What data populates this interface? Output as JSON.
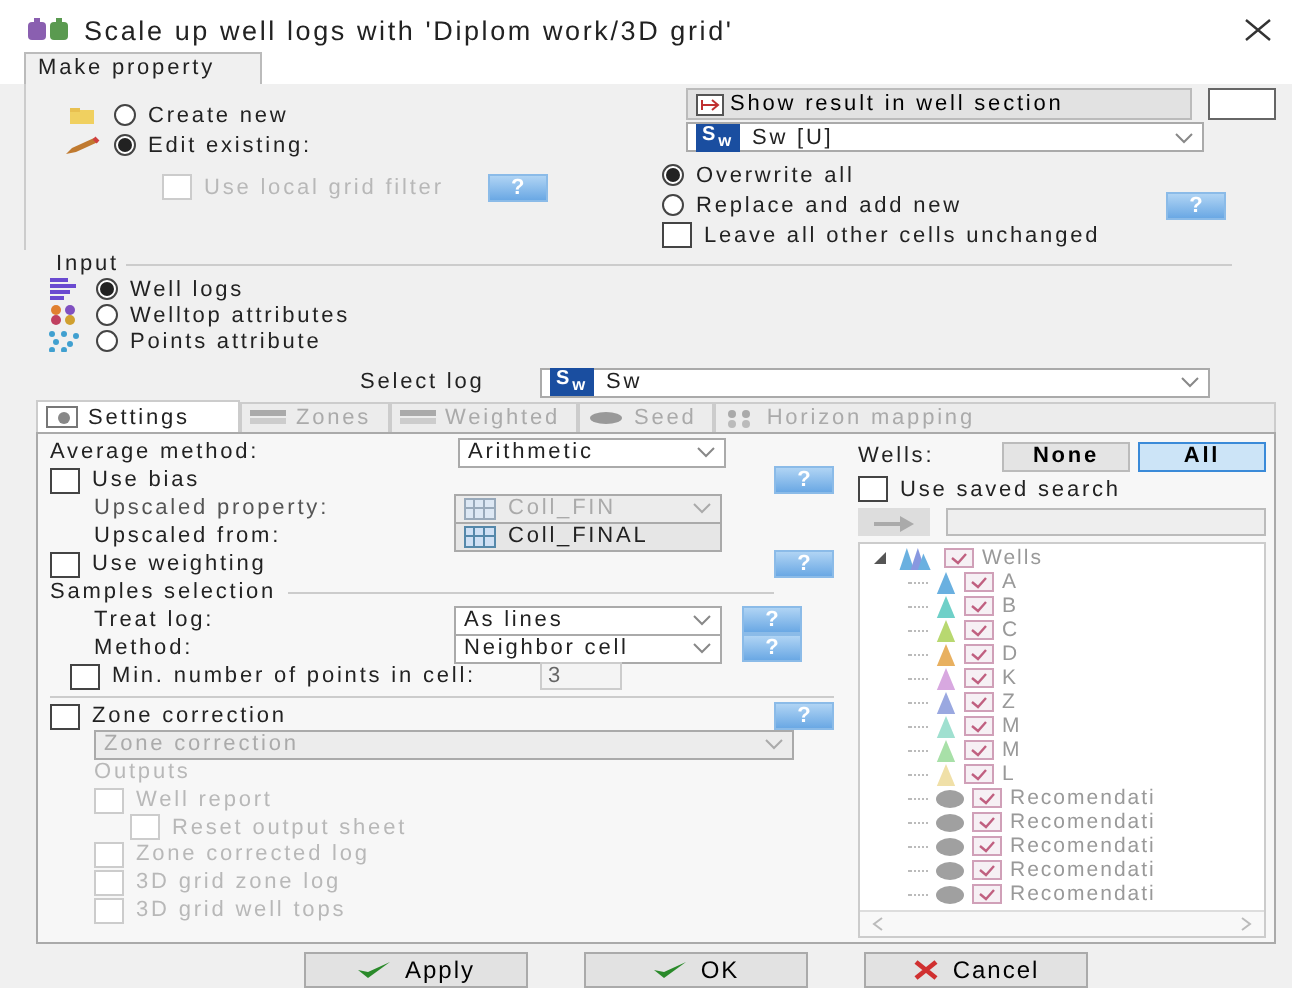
{
  "window": {
    "title": "Scale up well logs with 'Diplom work/3D grid'"
  },
  "top_tabs": [
    {
      "label": "Make property",
      "selected": true
    }
  ],
  "make_mode": [
    {
      "label": "Create new",
      "selected": false,
      "kind": "folder"
    },
    {
      "label": "Edit existing:",
      "selected": true,
      "kind": "pencil"
    }
  ],
  "local_grid_filter": {
    "label": "Use local grid filter",
    "checked": false,
    "disabled": true,
    "help": "?"
  },
  "show_result_button": "Show result in well section",
  "property_dropdown": {
    "badge": "S$_{w}$",
    "value": "Sw [U]"
  },
  "write_mode": [
    {
      "label": "Overwrite all",
      "selected": true
    },
    {
      "label": "Replace and add new",
      "selected": false,
      "help": "?"
    }
  ],
  "leave_unchanged": {
    "label": "Leave all other cells unchanged",
    "checked": false
  },
  "input": {
    "label": "Input",
    "options": [
      {
        "label": "Well logs",
        "selected": true,
        "kind": "logs"
      },
      {
        "label": "Welltop attributes",
        "selected": false,
        "kind": "tops"
      },
      {
        "label": "Points attribute",
        "selected": false,
        "kind": "points"
      }
    ]
  },
  "select_log": {
    "label": "Select log",
    "badge": "S$_{w}$",
    "value": "Sw"
  },
  "tabs": [
    {
      "label": "Settings",
      "selected": true,
      "disabled": false,
      "kind": "settings"
    },
    {
      "label": "Zones",
      "selected": false,
      "disabled": true,
      "kind": "zones"
    },
    {
      "label": "Weighted",
      "selected": false,
      "disabled": true,
      "kind": "weighted"
    },
    {
      "label": "Seed",
      "selected": false,
      "disabled": true,
      "kind": "seed"
    },
    {
      "label": "Horizon mapping",
      "selected": false,
      "disabled": true,
      "kind": "horizon"
    }
  ],
  "settings": {
    "average_method": {
      "label": "Average method:",
      "value": "Arithmetic"
    },
    "use_bias": {
      "label": "Use bias",
      "checked": false,
      "help": "?"
    },
    "upscaled_property": {
      "label": "Upscaled property:",
      "value": "Coll_FIN",
      "disabled": true
    },
    "upscaled_from": {
      "label": "Upscaled from:",
      "value": "Coll_FINAL"
    },
    "use_weighting": {
      "label": "Use weighting",
      "checked": false,
      "help": "?"
    },
    "samples_selection": {
      "label": "Samples selection",
      "treat_log": {
        "label": "Treat log:",
        "value": "As lines",
        "help": "?"
      },
      "method": {
        "label": "Method:",
        "value": "Neighbor cell",
        "help": "?"
      },
      "min_points": {
        "label": "Min. number of points in cell:",
        "checked": false,
        "value": "3"
      }
    },
    "zone_correction": {
      "label": "Zone correction",
      "checked": false,
      "help": "?",
      "dropdown": "Zone correction",
      "outputs_label": "Outputs",
      "outputs": [
        {
          "label": "Well report",
          "checked": false,
          "children": [
            {
              "label": "Reset output sheet",
              "checked": false
            }
          ]
        },
        {
          "label": "Zone corrected log",
          "checked": false
        },
        {
          "label": "3D grid zone log",
          "checked": false
        },
        {
          "label": "3D grid well tops",
          "checked": false
        }
      ]
    }
  },
  "wells": {
    "label": "Wells:",
    "buttons": [
      {
        "label": "None",
        "selected": false
      },
      {
        "label": "All",
        "selected": true
      }
    ],
    "use_saved_search": {
      "label": "Use saved search",
      "checked": false
    },
    "tree": {
      "label": "Wells",
      "checked": true,
      "expanded": true,
      "children": [
        {
          "label": "A",
          "checked": true,
          "kind": "well",
          "color": "#6ab0e0"
        },
        {
          "label": "B",
          "checked": true,
          "kind": "well",
          "color": "#6fd0c8"
        },
        {
          "label": "C",
          "checked": true,
          "kind": "well",
          "color": "#b8d870"
        },
        {
          "label": "D",
          "checked": true,
          "kind": "well",
          "color": "#e8b060"
        },
        {
          "label": "K",
          "checked": true,
          "kind": "well",
          "color": "#d8a8e0"
        },
        {
          "label": "Z",
          "checked": true,
          "kind": "well",
          "color": "#9aa8e0"
        },
        {
          "label": "M",
          "checked": true,
          "kind": "well",
          "color": "#a0e0d0"
        },
        {
          "label": "M",
          "checked": true,
          "kind": "well",
          "color": "#a8e0a8"
        },
        {
          "label": "L",
          "checked": true,
          "kind": "well",
          "color": "#f0e0a8"
        },
        {
          "label": "Recomendati",
          "checked": true,
          "kind": "point",
          "color": "#a0a0a0"
        },
        {
          "label": "Recomendati",
          "checked": true,
          "kind": "point",
          "color": "#a0a0a0"
        },
        {
          "label": "Recomendati",
          "checked": true,
          "kind": "point",
          "color": "#a0a0a0"
        },
        {
          "label": "Recomendati",
          "checked": true,
          "kind": "point",
          "color": "#a0a0a0"
        },
        {
          "label": "Recomendati",
          "checked": true,
          "kind": "point",
          "color": "#a0a0a0"
        }
      ]
    }
  },
  "footer_buttons": [
    {
      "label": "Apply",
      "kind": "check"
    },
    {
      "label": "OK",
      "kind": "check"
    },
    {
      "label": "Cancel",
      "kind": "cross"
    }
  ]
}
